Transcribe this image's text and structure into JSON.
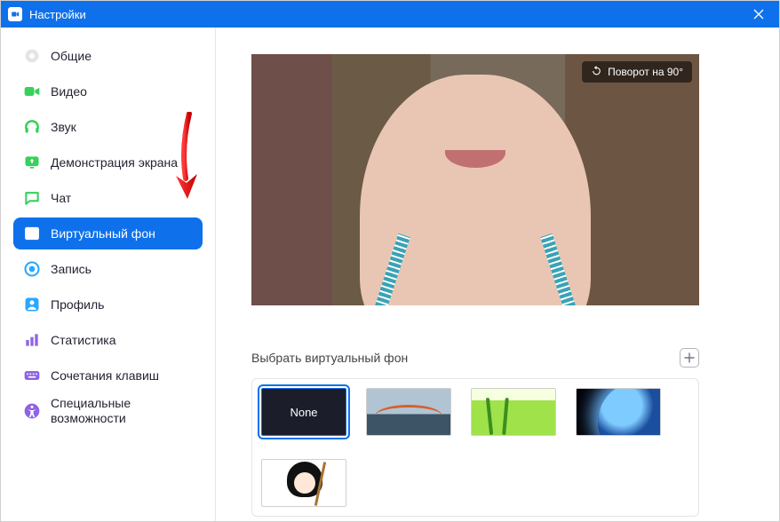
{
  "titlebar": {
    "title": "Настройки"
  },
  "sidebar": {
    "items": [
      {
        "label": "Общие"
      },
      {
        "label": "Видео"
      },
      {
        "label": "Звук"
      },
      {
        "label": "Демонстрация экрана"
      },
      {
        "label": "Чат"
      },
      {
        "label": "Виртуальный фон"
      },
      {
        "label": "Запись"
      },
      {
        "label": "Профиль"
      },
      {
        "label": "Статистика"
      },
      {
        "label": "Сочетания клавиш"
      },
      {
        "label": "Специальные возможности"
      }
    ]
  },
  "preview": {
    "rotate_label": "Поворот на 90°"
  },
  "vb": {
    "section_title": "Выбрать виртуальный фон",
    "none_label": "None"
  }
}
